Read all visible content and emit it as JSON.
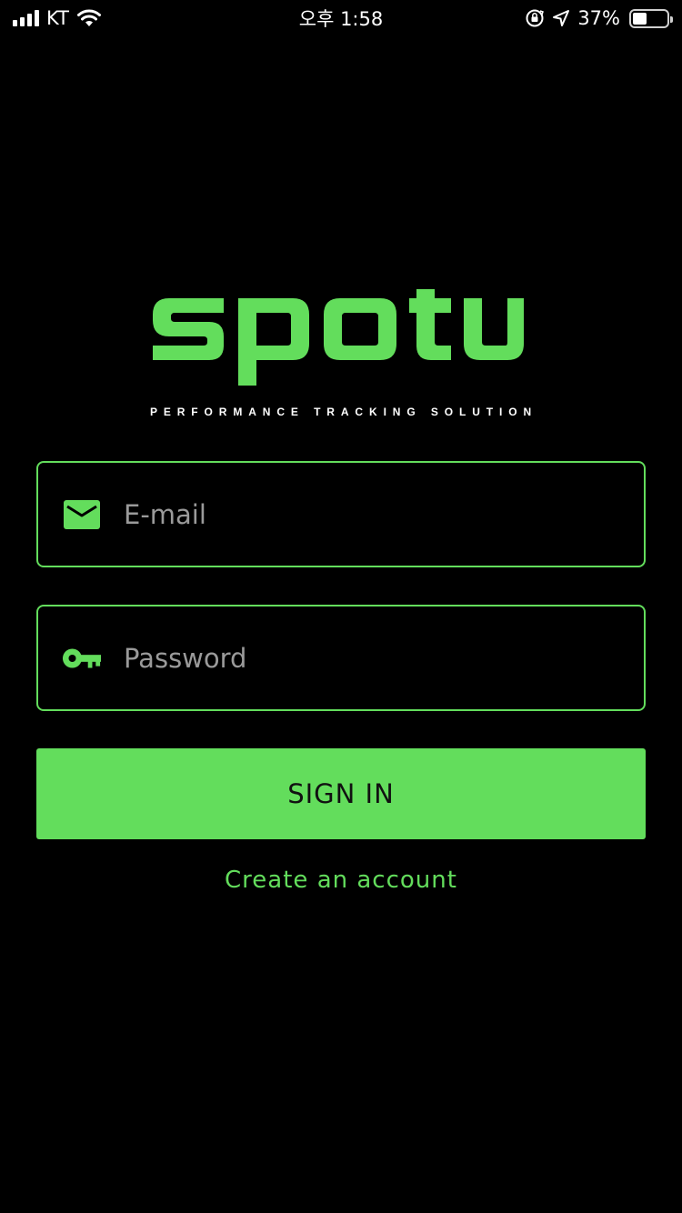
{
  "status_bar": {
    "carrier": "KT",
    "time": "오후 1:58",
    "battery_percent": "37%",
    "battery_level": 0.37,
    "icons": [
      "signal-icon",
      "wifi-icon",
      "orientation-lock-icon",
      "location-icon",
      "battery-icon"
    ]
  },
  "brand": {
    "logo_text": "spotu",
    "tagline": "PERFORMANCE TRACKING SOLUTION",
    "accent_color": "#63dd5c",
    "background_color": "#000000"
  },
  "form": {
    "email": {
      "placeholder": "E-mail",
      "value": "",
      "icon": "mail-icon"
    },
    "password": {
      "placeholder": "Password",
      "value": "",
      "icon": "key-icon"
    },
    "sign_in_label": "SIGN IN",
    "create_account_label": "Create an account"
  }
}
